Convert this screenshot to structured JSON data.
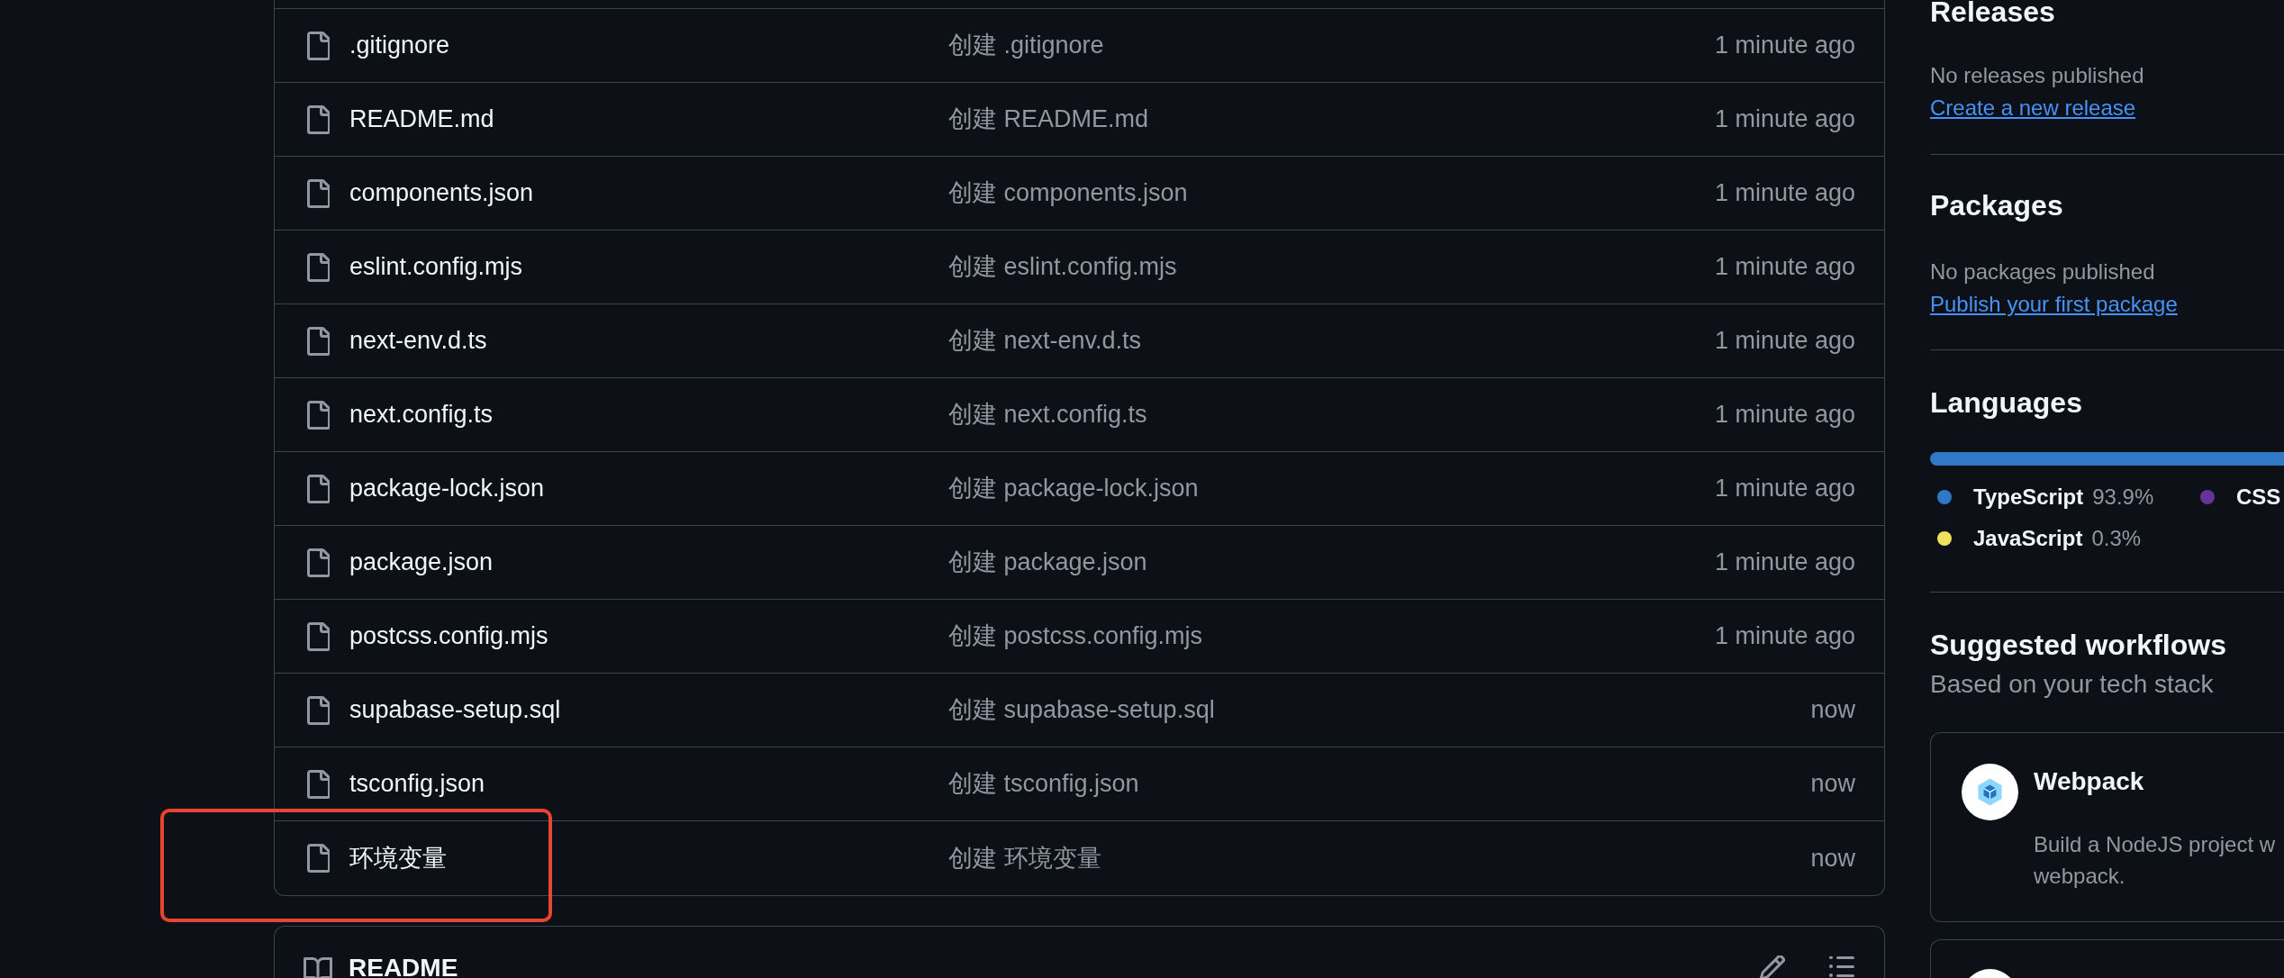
{
  "file_list": {
    "files": [
      {
        "name": ".gitignore",
        "commit_message": "创建 .gitignore",
        "time": "1 minute ago",
        "highlighted": false
      },
      {
        "name": "README.md",
        "commit_message": "创建 README.md",
        "time": "1 minute ago",
        "highlighted": false
      },
      {
        "name": "components.json",
        "commit_message": "创建 components.json",
        "time": "1 minute ago",
        "highlighted": false
      },
      {
        "name": "eslint.config.mjs",
        "commit_message": "创建 eslint.config.mjs",
        "time": "1 minute ago",
        "highlighted": false
      },
      {
        "name": "next-env.d.ts",
        "commit_message": "创建 next-env.d.ts",
        "time": "1 minute ago",
        "highlighted": false
      },
      {
        "name": "next.config.ts",
        "commit_message": "创建 next.config.ts",
        "time": "1 minute ago",
        "highlighted": false
      },
      {
        "name": "package-lock.json",
        "commit_message": "创建 package-lock.json",
        "time": "1 minute ago",
        "highlighted": false
      },
      {
        "name": "package.json",
        "commit_message": "创建 package.json",
        "time": "1 minute ago",
        "highlighted": false
      },
      {
        "name": "postcss.config.mjs",
        "commit_message": "创建 postcss.config.mjs",
        "time": "1 minute ago",
        "highlighted": false
      },
      {
        "name": "supabase-setup.sql",
        "commit_message": "创建 supabase-setup.sql",
        "time": "now",
        "highlighted": false
      },
      {
        "name": "tsconfig.json",
        "commit_message": "创建 tsconfig.json",
        "time": "now",
        "highlighted": false
      },
      {
        "name": "环境变量",
        "commit_message": "创建 环境变量",
        "time": "now",
        "highlighted": true
      }
    ]
  },
  "readme": {
    "title": "README"
  },
  "sidebar": {
    "releases": {
      "heading": "Releases",
      "note": "No releases published",
      "link": "Create a new release"
    },
    "packages": {
      "heading": "Packages",
      "note": "No packages published",
      "link": "Publish your first package"
    },
    "languages": {
      "heading": "Languages",
      "items": [
        {
          "name": "TypeScript",
          "percent": "93.9%",
          "color": "#3178c6"
        },
        {
          "name": "CSS",
          "color": "#663399"
        },
        {
          "name": "JavaScript",
          "percent": "0.3%",
          "color": "#f1e05a"
        }
      ]
    },
    "suggested_workflows": {
      "heading": "Suggested workflows",
      "subheading": "Based on your tech stack",
      "workflows": [
        {
          "kind": "full",
          "title": "Webpack",
          "description_lines": [
            "Build a NodeJS project w",
            "webpack."
          ]
        },
        {
          "kind": "cut"
        }
      ]
    }
  }
}
